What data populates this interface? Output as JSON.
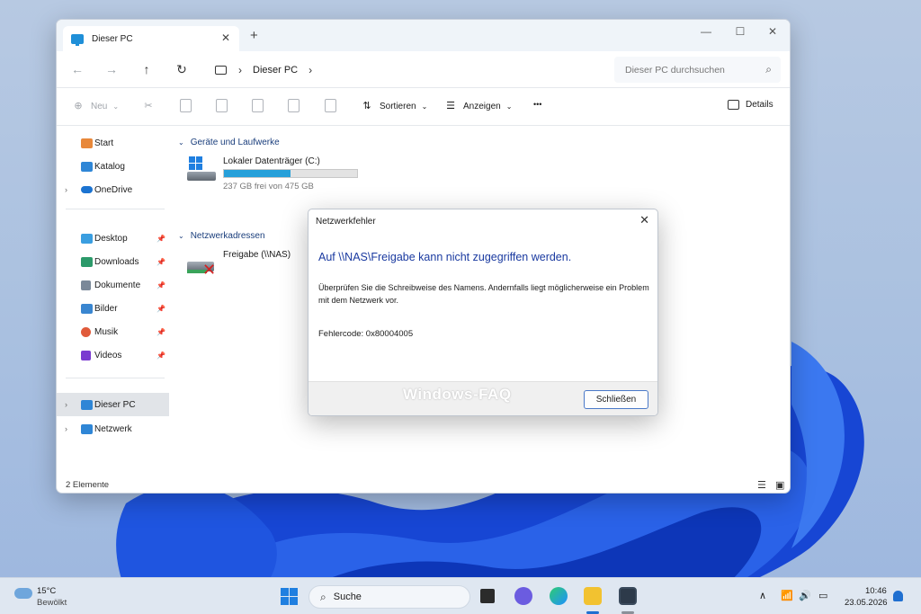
{
  "colors": {
    "accent": "#1f7fe0",
    "link_blue": "#1a3aa0",
    "group_blue": "#1a3e7c",
    "progress": "#26a0da"
  },
  "explorer": {
    "tab_title": "Dieser PC",
    "tab_close": "✕",
    "new_tab": "+",
    "window_controls": {
      "minimize": "—",
      "maximize": "☐",
      "close": "✕"
    },
    "nav": {
      "back": "←",
      "forward": "→",
      "up": "↑",
      "refresh": "↻"
    },
    "address": {
      "chevron": "›",
      "crumb": "Dieser PC",
      "trail_chevron": "›"
    },
    "search": {
      "placeholder": "Dieser PC durchsuchen",
      "icon": "search-icon"
    },
    "toolbar": {
      "new_label": "Neu",
      "sort_label": "Sortieren",
      "view_label": "Anzeigen",
      "more_label": "•••",
      "details_label": "Details"
    },
    "sidebar": {
      "items": [
        {
          "label": "Start",
          "icon": "home-icon",
          "color": "#e8883a"
        },
        {
          "label": "Katalog",
          "icon": "gallery-icon",
          "color": "#2f86d6"
        },
        {
          "label": "OneDrive",
          "icon": "cloud-icon",
          "color": "#1b73d1"
        },
        {
          "label": "Desktop",
          "icon": "desktop-icon",
          "color": "#3a9ee0"
        },
        {
          "label": "Downloads",
          "icon": "download-icon",
          "color": "#2c9a6a"
        },
        {
          "label": "Dokumente",
          "icon": "document-icon",
          "color": "#7a8899"
        },
        {
          "label": "Bilder",
          "icon": "pictures-icon",
          "color": "#3a86d0"
        },
        {
          "label": "Musik",
          "icon": "music-icon",
          "color": "#e05a3a"
        },
        {
          "label": "Videos",
          "icon": "video-icon",
          "color": "#7a3ad0"
        },
        {
          "label": "Dieser PC",
          "icon": "pc-icon",
          "color": "#2f86d6"
        },
        {
          "label": "Netzwerk",
          "icon": "network-icon",
          "color": "#2f86d6"
        }
      ]
    },
    "content": {
      "group_drives": "Geräte und Laufwerke",
      "drive_name": "Lokaler Datenträger (C:)",
      "drive_free": "237 GB frei von 475 GB",
      "drive_used_fraction": 0.5,
      "group_network": "Netzwerkadressen",
      "network_item": "Freigabe (\\\\NAS)"
    },
    "status": "2 Elemente"
  },
  "dialog": {
    "title": "Netzwerkfehler",
    "close": "✕",
    "heading": "Auf \\\\NAS\\Freigabe kann nicht zugegriffen werden.",
    "body": "Überprüfen Sie die Schreibweise des Namens. Andernfalls liegt möglicherweise ein Problem mit dem Netzwerk vor.",
    "error_code": "Fehlercode: 0x80004005",
    "button": "Schließen",
    "watermark": "Windows-FAQ"
  },
  "taskbar": {
    "weather_temp": "15°C",
    "weather_desc": "Bewölkt",
    "search_label": "Suche",
    "time": "10:46",
    "date": "23.05.2026"
  }
}
